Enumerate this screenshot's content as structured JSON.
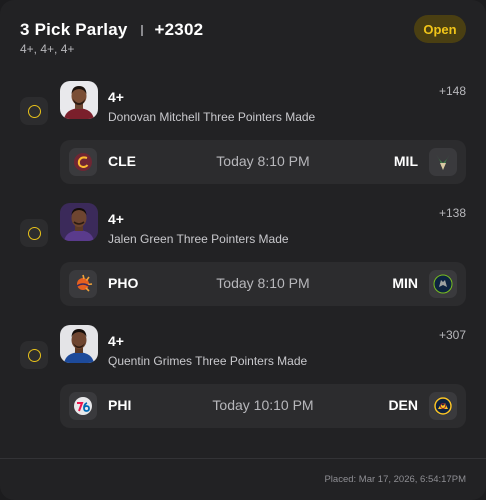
{
  "parlay": {
    "title": "3 Pick Parlay",
    "odds": "+2302",
    "subtitle": "4+, 4+, 4+",
    "status": "Open"
  },
  "legs": [
    {
      "line": "4+",
      "player": "Donovan Mitchell Three Pointers Made",
      "odds": "+148",
      "home_team": "CLE",
      "game_time": "Today 8:10 PM",
      "away_team": "MIL",
      "home_logo": "cavaliers-logo-icon",
      "away_logo": "bucks-logo-icon"
    },
    {
      "line": "4+",
      "player": "Jalen Green Three Pointers Made",
      "odds": "+138",
      "home_team": "PHO",
      "game_time": "Today 8:10 PM",
      "away_team": "MIN",
      "home_logo": "suns-logo-icon",
      "away_logo": "timberwolves-logo-icon"
    },
    {
      "line": "4+",
      "player": "Quentin Grimes Three Pointers Made",
      "odds": "+307",
      "home_team": "PHI",
      "game_time": "Today 10:10 PM",
      "away_team": "DEN",
      "home_logo": "76ers-logo-icon",
      "away_logo": "nuggets-logo-icon"
    }
  ],
  "footer": {
    "placed": "Placed: Mar 17, 2026, 6:54:17PM"
  },
  "colors": {
    "accent": "#f0c419",
    "background": "#222224",
    "panel": "#2c2c2e"
  }
}
